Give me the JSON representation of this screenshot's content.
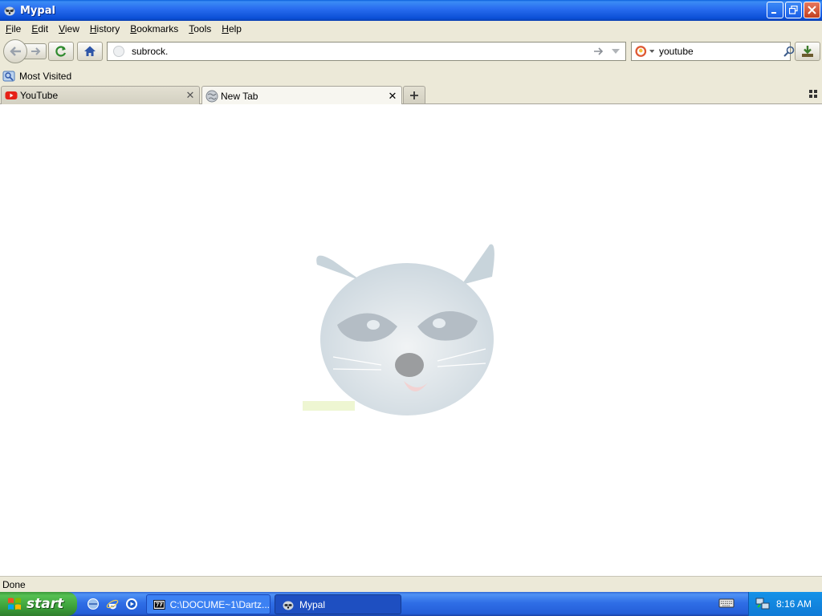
{
  "window": {
    "title": "Mypal"
  },
  "menu": [
    {
      "label": "File",
      "accel": "F",
      "rest": "ile"
    },
    {
      "label": "Edit",
      "accel": "E",
      "rest": "dit"
    },
    {
      "label": "View",
      "accel": "V",
      "rest": "iew"
    },
    {
      "label": "History",
      "accel": "H",
      "rest": "istory"
    },
    {
      "label": "Bookmarks",
      "accel": "B",
      "rest": "ookmarks"
    },
    {
      "label": "Tools",
      "accel": "T",
      "rest": "ools"
    },
    {
      "label": "Help",
      "accel": "H",
      "rest": "elp"
    }
  ],
  "nav": {
    "url_value": "subrock.",
    "search_value": "youtube"
  },
  "bookmarks": {
    "most_visited": "Most Visited"
  },
  "tabs": [
    {
      "label": "YouTube",
      "icon": "youtube-icon",
      "active": false
    },
    {
      "label": "New Tab",
      "icon": "globe-icon",
      "active": true
    }
  ],
  "content": {
    "logo_icon": "raccoon-logo"
  },
  "status": {
    "text": "Done"
  },
  "taskbar": {
    "start_label": "start",
    "tasks": [
      {
        "label": "C:\\DOCUME~1\\Dartz...",
        "icon": "7zip-icon"
      },
      {
        "label": "Mypal",
        "icon": "mypal-icon"
      }
    ],
    "clock": "8:16 AM"
  },
  "colors": {
    "titlebar": "#0b4fd6",
    "taskbar": "#245ed8",
    "start_button": "#3da23b",
    "tray": "#0f7ad6",
    "chrome": "#ece9d8"
  }
}
